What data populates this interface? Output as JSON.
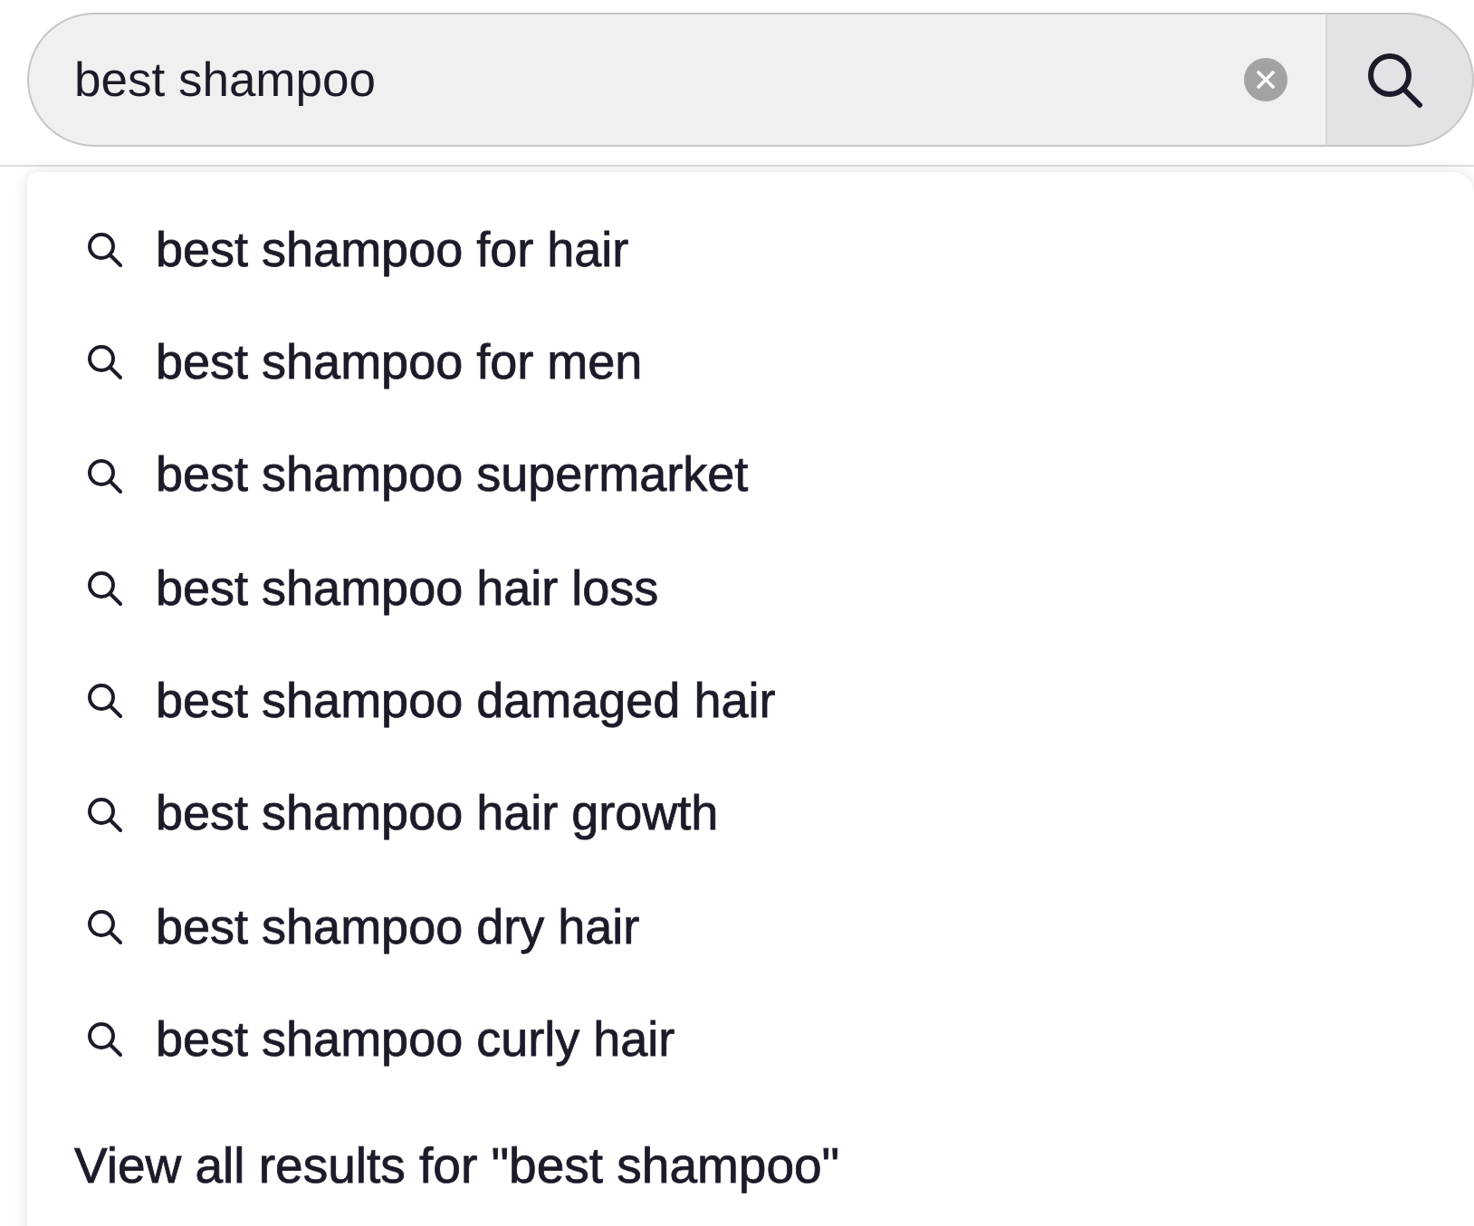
{
  "search": {
    "value": "best shampoo"
  },
  "suggestions": [
    {
      "text": "best shampoo for hair"
    },
    {
      "text": "best shampoo for men"
    },
    {
      "text": "best shampoo supermarket"
    },
    {
      "text": "best shampoo hair loss"
    },
    {
      "text": "best shampoo damaged hair"
    },
    {
      "text": "best shampoo hair growth"
    },
    {
      "text": "best shampoo dry hair"
    },
    {
      "text": "best shampoo curly hair"
    }
  ],
  "view_all": {
    "text": "View all results for \"best shampoo\""
  }
}
